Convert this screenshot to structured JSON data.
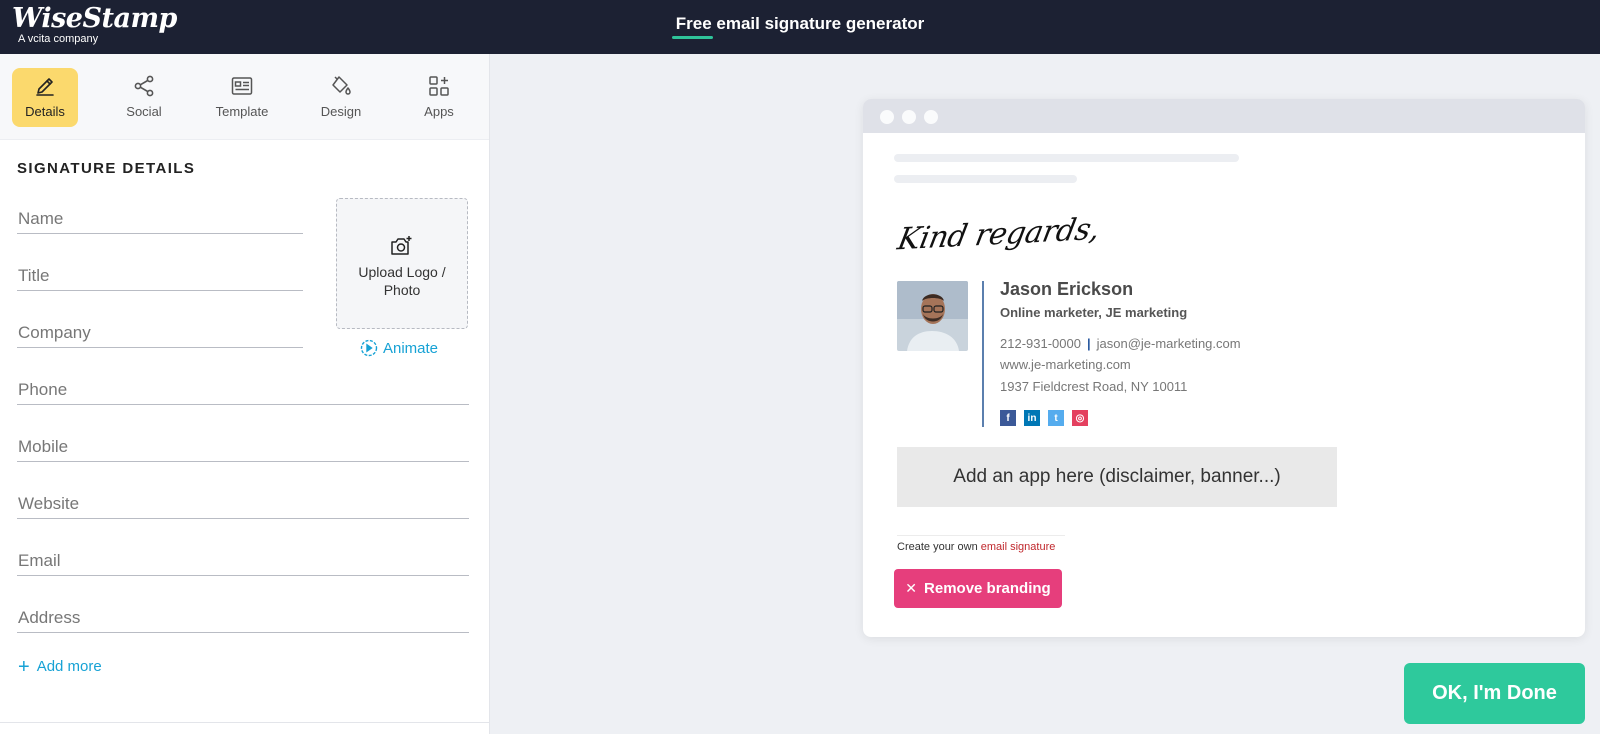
{
  "header": {
    "logo_text": "WiseStamp",
    "logo_subtitle": "A vcita company",
    "title_highlight": "Free",
    "title_rest": " email signature generator"
  },
  "tabs": [
    {
      "label": "Details",
      "icon": "pencil-icon",
      "active": true
    },
    {
      "label": "Social",
      "icon": "share-icon",
      "active": false
    },
    {
      "label": "Template",
      "icon": "template-icon",
      "active": false
    },
    {
      "label": "Design",
      "icon": "paint-bucket-icon",
      "active": false
    },
    {
      "label": "Apps",
      "icon": "apps-grid-icon",
      "active": false
    }
  ],
  "details": {
    "section_title": "SIGNATURE DETAILS",
    "fields": {
      "name": "Name",
      "title": "Title",
      "company": "Company",
      "phone": "Phone",
      "mobile": "Mobile",
      "website": "Website",
      "email": "Email",
      "address": "Address"
    },
    "upload_label": "Upload Logo / Photo",
    "animate_label": "Animate",
    "add_more_label": "Add more"
  },
  "preview": {
    "greeting": "Kind regards,",
    "name": "Jason Erickson",
    "role": "Online marketer, JE marketing",
    "phone": "212-931-0000",
    "separator": "|",
    "email": "jason@je-marketing.com",
    "website": "www.je-marketing.com",
    "address": "1937 Fieldcrest Road, NY 10011",
    "social_icons": [
      {
        "name": "facebook-icon",
        "glyph": "f",
        "color": "#3b5998"
      },
      {
        "name": "linkedin-icon",
        "glyph": "in",
        "color": "#0077b5"
      },
      {
        "name": "twitter-icon",
        "glyph": "t",
        "color": "#55acee"
      },
      {
        "name": "instagram-icon",
        "glyph": "◎",
        "color": "#e4405f"
      }
    ],
    "app_banner": "Add an app here (disclaimer, banner...)",
    "create_text": "Create your own ",
    "create_link": "email signature",
    "remove_branding": "Remove branding"
  },
  "done_button": "OK, I'm Done",
  "colors": {
    "header_bg": "#1c2133",
    "active_tab": "#fbd96d",
    "accent_blue": "#17a2d5",
    "remove_branding": "#e63e7c",
    "done": "#2ec99c"
  }
}
